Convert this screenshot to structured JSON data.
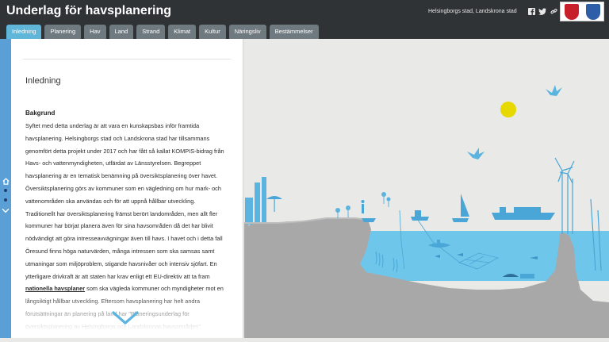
{
  "header": {
    "title": "Underlag för havsplanering",
    "org_text": "Helsingborgs stad, Landskrona stad",
    "share": [
      "facebook-icon",
      "twitter-icon",
      "link-icon"
    ],
    "logos": [
      "helsingborg-logo",
      "landskrona-logo"
    ]
  },
  "tabs": [
    {
      "label": "Inledning",
      "active": true
    },
    {
      "label": "Planering",
      "active": false
    },
    {
      "label": "Hav",
      "active": false
    },
    {
      "label": "Land",
      "active": false
    },
    {
      "label": "Strand",
      "active": false
    },
    {
      "label": "Klimat",
      "active": false
    },
    {
      "label": "Kultur",
      "active": false
    },
    {
      "label": "Näringsliv",
      "active": false
    },
    {
      "label": "Bestämmelser",
      "active": false
    }
  ],
  "panel": {
    "section_title": "Inledning",
    "subheading": "Bakgrund",
    "lines": [
      "Syftet med detta underlag är att vara en kunskapsbas inför framtida",
      "havsplanering. Helsingborgs stad och Landskrona stad har tillsammans",
      "genomfört detta projekt under 2017 och har fått så kallat KOMPIS-bidrag från",
      "Havs- och vattenmyndigheten, utfärdat av Länsstyrelsen. Begreppet",
      "havsplanering är en tematisk benämning på översiktsplanering över havet.",
      "Översiktsplanering görs av kommuner som en vägledning om hur mark- och",
      "vattenområden ska användas och för att uppnå hållbar utveckling.",
      "Traditionellt har översiktsplanering främst berört landområden, men allt fler",
      "kommuner har börjat planera även för sina havsområden då det har blivit",
      "nödvändigt att göra intresseavvägningar även till havs. I havet och i detta fall",
      "Öresund finns höga naturvärden, många intressen som ska samsas samt",
      "utmaningar som miljöproblem, stigande havsnivåer och intensiv sjöfart. En",
      "ytterligare drivkraft är att staten har krav enligt ett EU-direktiv att ta fram"
    ],
    "link_text": "nationella havsplaner",
    "link_rest": " som ska vägleda kommuner och myndigheter mot en",
    "lines_after": [
      "långsiktigt hållbar utveckling. Eftersom havsplanering har helt andra",
      "förutsättningar än planering på land har \"Planeringsunderlag för",
      "översiktsplanering av Helsingborgs och Landskronas havsområden\""
    ]
  },
  "colors": {
    "header_bg": "#2f3336",
    "tab_active": "#5fb6d9",
    "tab_inactive": "#6f7a80",
    "water": "#6ec6ea",
    "land": "#a8a8a8",
    "sky": "#e9e9e7",
    "sun": "#e6d800",
    "side_strip": "#5a9fd6"
  }
}
